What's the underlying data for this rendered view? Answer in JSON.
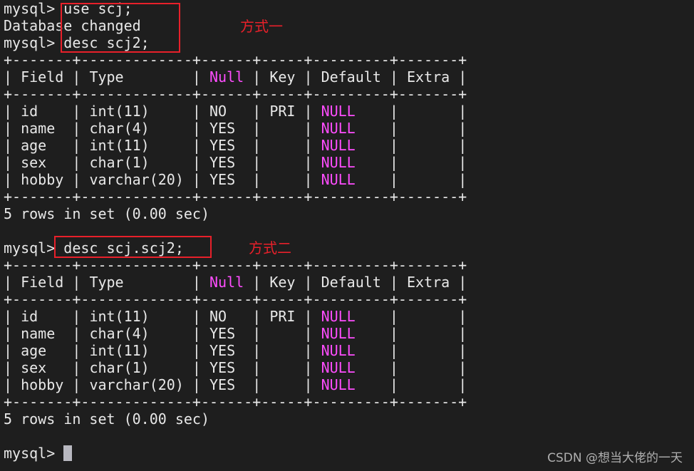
{
  "terminal": {
    "prompt": "mysql> ",
    "session_1": {
      "cmd_use": "use scj;",
      "msg_changed": "Database changed",
      "cmd_desc": "desc scj2;",
      "annotation": "方式一",
      "result_summary": "5 rows in set (0.00 sec)"
    },
    "session_2": {
      "cmd_desc": "desc scj.scj2;",
      "annotation": "方式二",
      "result_summary": "5 rows in set (0.00 sec)"
    },
    "table": {
      "border": "+-------+-------------+------+-----+---------+-------+",
      "headers": [
        "Field",
        "Type",
        "Null",
        "Key",
        "Default",
        "Extra"
      ],
      "rows": [
        {
          "field": "id",
          "type": "int(11)",
          "null": "NO",
          "key": "PRI",
          "default": "NULL",
          "extra": ""
        },
        {
          "field": "name",
          "type": "char(4)",
          "null": "YES",
          "key": "",
          "default": "NULL",
          "extra": ""
        },
        {
          "field": "age",
          "type": "int(11)",
          "null": "YES",
          "key": "",
          "default": "NULL",
          "extra": ""
        },
        {
          "field": "sex",
          "type": "char(1)",
          "null": "YES",
          "key": "",
          "default": "NULL",
          "extra": ""
        },
        {
          "field": "hobby",
          "type": "varchar(20)",
          "null": "YES",
          "key": "",
          "default": "NULL",
          "extra": ""
        }
      ]
    }
  },
  "watermark": "CSDN @想当大佬的一天",
  "colors": {
    "background": "#1e1e1e",
    "text": "#e8e8e8",
    "highlight_magenta": "#ff4dff",
    "annotation_red": "#e8202a"
  }
}
